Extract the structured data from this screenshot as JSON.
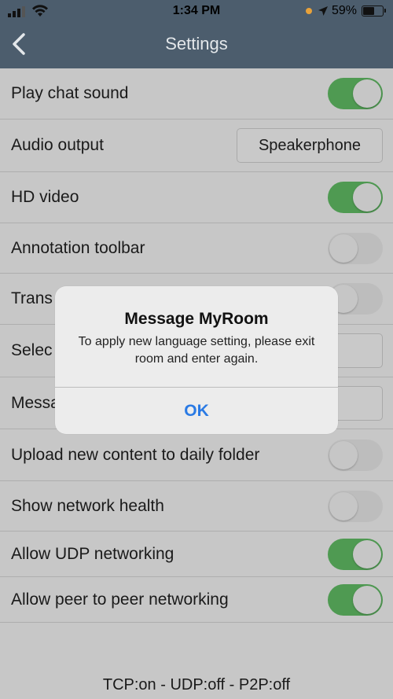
{
  "status_bar": {
    "time": "1:34 PM",
    "battery_percent": "59%",
    "battery_level": 0.59
  },
  "nav": {
    "title": "Settings",
    "back_icon": "chevron-left-icon"
  },
  "settings": [
    {
      "label": "Play chat sound",
      "control": "toggle",
      "on": true
    },
    {
      "label": "Audio output",
      "control": "select",
      "value": "Speakerphone"
    },
    {
      "label": "HD video",
      "control": "toggle",
      "on": true
    },
    {
      "label": "Annotation toolbar",
      "control": "toggle",
      "on": false
    },
    {
      "label": "Trans",
      "control": "toggle",
      "on": false
    },
    {
      "label": "Selec",
      "control": "select",
      "value": ""
    },
    {
      "label": "Messa",
      "control": "select",
      "value": ""
    },
    {
      "label": "Upload new content to daily folder",
      "control": "toggle",
      "on": false
    },
    {
      "label": "Show network health",
      "control": "toggle",
      "on": false
    },
    {
      "label": "Allow UDP networking",
      "control": "toggle",
      "on": true
    },
    {
      "label": "Allow peer to peer networking",
      "control": "toggle",
      "on": true
    }
  ],
  "footer": {
    "text": "TCP:on - UDP:off - P2P:off"
  },
  "alert": {
    "title": "Message MyRoom",
    "message": "To apply new language setting, please exit room and enter again.",
    "ok_label": "OK"
  },
  "colors": {
    "nav_bg": "#4c5d6d",
    "toggle_on": "#4f9a52",
    "toggle_off": "#bdbdbd",
    "alert_button": "#2a7ae4",
    "page_bg": "#c7c7c7"
  }
}
